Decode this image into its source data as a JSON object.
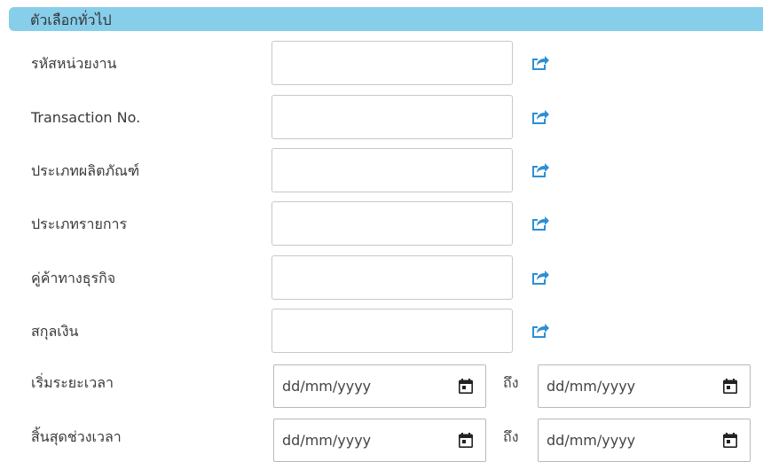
{
  "header": {
    "title": "ตัวเลือกทั่วไป"
  },
  "fields": [
    {
      "label": "รหัสหน่วยงาน",
      "value": ""
    },
    {
      "label": "Transaction No.",
      "value": ""
    },
    {
      "label": "ประเภทผลิตภัณฑ์",
      "value": ""
    },
    {
      "label": "ประเภทรายการ",
      "value": ""
    },
    {
      "label": "คู่ค้าทางธุรกิจ",
      "value": ""
    },
    {
      "label": "สกุลเงิน",
      "value": ""
    }
  ],
  "date_rows": [
    {
      "label": "เริ่มระยะเวลา",
      "from_placeholder": "dd/mm/yyyy",
      "to_label": "ถึง",
      "to_placeholder": "dd/mm/yyyy"
    },
    {
      "label": "สิ้นสุดช่วงเวลา",
      "from_placeholder": "dd/mm/yyyy",
      "to_label": "ถึง",
      "to_placeholder": "dd/mm/yyyy"
    }
  ],
  "icons": {
    "lookup": "share-square-icon",
    "calendar": "calendar-icon"
  },
  "colors": {
    "header_bg": "#87ceeb",
    "icon_blue": "#2d8fd5"
  }
}
